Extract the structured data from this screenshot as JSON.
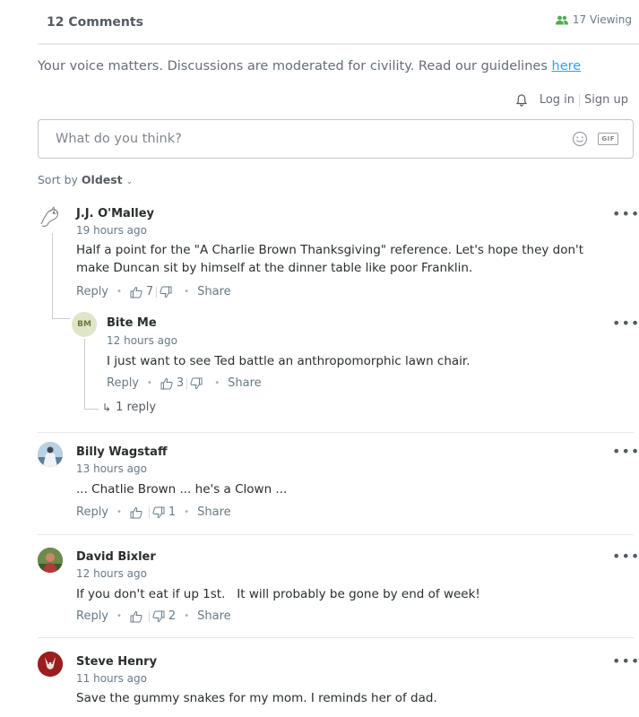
{
  "header": {
    "comment_count": "12 Comments",
    "viewing": "17 Viewing"
  },
  "notice": {
    "text": "Your voice matters. Discussions are moderated for civility. Read our guidelines ",
    "link": "here"
  },
  "auth": {
    "login": "Log in",
    "signup": "Sign up"
  },
  "composer": {
    "placeholder": "What do you think?",
    "gif_label": "GIF"
  },
  "sort": {
    "label": "Sort by ",
    "value": "Oldest"
  },
  "actions": {
    "reply": "Reply",
    "share": "Share",
    "more": "•••"
  },
  "comments": [
    {
      "author": "J.J. O'Malley",
      "time": "19 hours ago",
      "body": "Half a point for the \"A Charlie Brown Thanksgiving\" reference. Let's hope they don't make Duncan sit by himself at the dinner table like poor Franklin.",
      "upvotes": "7",
      "downvotes": ""
    },
    {
      "author": "Bite Me",
      "initials": "BM",
      "time": "12 hours ago",
      "body": "I just want to see Ted battle an anthropomorphic lawn chair.",
      "upvotes": "3",
      "downvotes": "",
      "replies": "1 reply"
    },
    {
      "author": "Billy Wagstaff",
      "time": "13 hours ago",
      "body": "... Chatlie Brown ... he's a Clown ...",
      "upvotes": "",
      "downvotes": "1"
    },
    {
      "author": "David Bixler",
      "time": "12 hours ago",
      "body": "If you don't eat if up 1st.   It will probably be gone by end of week!",
      "upvotes": "",
      "downvotes": "2"
    },
    {
      "author": "Steve Henry",
      "time": "11 hours ago",
      "body": "Save the gummy snakes for my mom. I reminds her of dad.",
      "upvotes": "",
      "downvotes": ""
    }
  ],
  "colors": {
    "accent": "#2e9fff",
    "viewing_icon": "#4caf50",
    "text": "#2a2e2e",
    "muted": "#687a86"
  }
}
